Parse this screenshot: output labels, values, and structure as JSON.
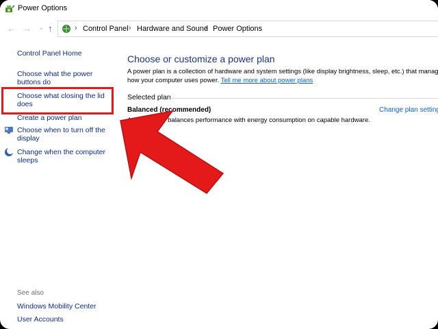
{
  "window": {
    "title": "Power Options"
  },
  "breadcrumb": [
    "Control Panel",
    "Hardware and Sound",
    "Power Options"
  ],
  "breadcrumb_sep": "›",
  "nav": {
    "back": "←",
    "forward": "→",
    "recent": "⌄",
    "up": "↑"
  },
  "sidebar": {
    "home": "Control Panel Home",
    "items": [
      {
        "label": "Choose what the power buttons do"
      },
      {
        "label": "Choose what closing the lid does"
      },
      {
        "label": "Create a power plan"
      },
      {
        "label": "Choose when to turn off the display"
      },
      {
        "label": "Change when the computer sleeps"
      }
    ],
    "see_also_title": "See also",
    "see_also": [
      "Windows Mobility Center",
      "User Accounts"
    ]
  },
  "main": {
    "heading": "Choose or customize a power plan",
    "description_1": "A power plan is a collection of hardware and system settings (like display brightness, sleep, etc.) that manages",
    "description_2": "how your computer uses power. ",
    "learn_more": "Tell me more about power plans",
    "selected_plan_label": "Selected plan",
    "plan_name": "Balanced (recommended)",
    "plan_description": "Automatically balances performance with energy consumption on capable hardware.",
    "change_settings": "Change plan settings"
  },
  "colors": {
    "accent": "#e41a1a",
    "link": "#0a5fd6",
    "heading": "#1e3287"
  }
}
